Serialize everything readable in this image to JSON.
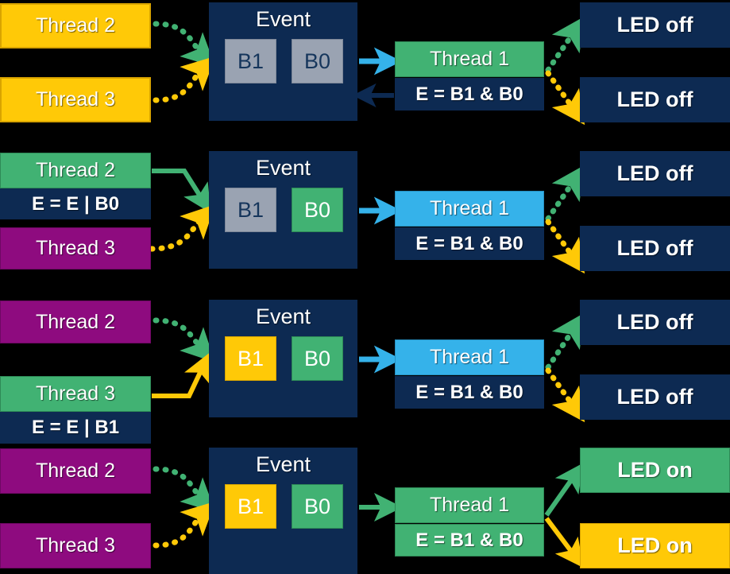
{
  "diagram": {
    "title_icon": "state-sequence-diagram",
    "colors": {
      "background": "#000000",
      "navy": "#0d2a52",
      "yellow": "#ffc907",
      "green": "#41b273",
      "purple": "#8e0b7f",
      "blue": "#35b2ea",
      "gray": "#9aa3b2",
      "white": "#ffffff",
      "navy_text": "#16365c"
    },
    "labels": {
      "event": "Event",
      "bit_high": "B1",
      "bit_low": "B0",
      "thread1": "Thread 1",
      "thread2": "Thread 2",
      "thread3": "Thread 3",
      "expr_and": "E = B1 & B0",
      "expr_or_b0": "E = E | B0",
      "expr_or_b1": "E = E | B1",
      "led_off": "LED off",
      "led_on": "LED on"
    },
    "rows": [
      {
        "index": 1,
        "left": [
          {
            "name": "thread-2-box",
            "label": "Thread 2",
            "fill": "yellow",
            "expr": null
          },
          {
            "name": "thread-3-box",
            "label": "Thread 3",
            "fill": "yellow",
            "expr": null
          }
        ],
        "event": {
          "label": "Event",
          "bits": [
            {
              "name": "B1",
              "fill": "gray"
            },
            {
              "name": "B0",
              "fill": "gray"
            }
          ]
        },
        "thread1": {
          "label": "Thread 1",
          "fill": "green",
          "expr": "E = B1 & B0",
          "expr_fill": "navy"
        },
        "leds": [
          {
            "name": "led-top",
            "label": "LED off",
            "fill": "navy"
          },
          {
            "name": "led-bottom",
            "label": "LED off",
            "fill": "navy"
          }
        ],
        "arrows": {
          "thread2_to_event": "green-dotted",
          "thread3_to_event": "yellow-dotted",
          "event_to_thread1": "blue-solid",
          "thread1_to_event": "navy-solid",
          "thread1_to_led_top": "green-dotted",
          "thread1_to_led_bottom": "yellow-dotted"
        }
      },
      {
        "index": 2,
        "left": [
          {
            "name": "thread-2-box",
            "label": "Thread 2",
            "fill": "green",
            "expr": "E = E | B0"
          },
          {
            "name": "thread-3-box",
            "label": "Thread 3",
            "fill": "purple",
            "expr": null
          }
        ],
        "event": {
          "label": "Event",
          "bits": [
            {
              "name": "B1",
              "fill": "gray"
            },
            {
              "name": "B0",
              "fill": "green"
            }
          ]
        },
        "thread1": {
          "label": "Thread 1",
          "fill": "blue",
          "expr": "E = B1 & B0",
          "expr_fill": "navy"
        },
        "leds": [
          {
            "name": "led-top",
            "label": "LED off",
            "fill": "navy"
          },
          {
            "name": "led-bottom",
            "label": "LED off",
            "fill": "navy"
          }
        ],
        "arrows": {
          "thread2_to_event": "green-solid",
          "thread3_to_event": "yellow-dotted",
          "event_to_thread1": "blue-solid",
          "thread1_to_led_top": "green-dotted",
          "thread1_to_led_bottom": "yellow-dotted"
        }
      },
      {
        "index": 3,
        "left": [
          {
            "name": "thread-2-box",
            "label": "Thread 2",
            "fill": "purple",
            "expr": null
          },
          {
            "name": "thread-3-box",
            "label": "Thread 3",
            "fill": "green",
            "expr": "E = E | B1"
          }
        ],
        "event": {
          "label": "Event",
          "bits": [
            {
              "name": "B1",
              "fill": "yellow"
            },
            {
              "name": "B0",
              "fill": "green"
            }
          ]
        },
        "thread1": {
          "label": "Thread 1",
          "fill": "blue",
          "expr": "E = B1 & B0",
          "expr_fill": "navy"
        },
        "leds": [
          {
            "name": "led-top",
            "label": "LED off",
            "fill": "navy"
          },
          {
            "name": "led-bottom",
            "label": "LED off",
            "fill": "navy"
          }
        ],
        "arrows": {
          "thread2_to_event": "green-dotted",
          "thread3_to_event": "yellow-solid",
          "event_to_thread1": "blue-solid",
          "thread1_to_led_top": "green-dotted",
          "thread1_to_led_bottom": "yellow-dotted"
        }
      },
      {
        "index": 4,
        "left": [
          {
            "name": "thread-2-box",
            "label": "Thread 2",
            "fill": "purple",
            "expr": null
          },
          {
            "name": "thread-3-box",
            "label": "Thread 3",
            "fill": "purple",
            "expr": null
          }
        ],
        "event": {
          "label": "Event",
          "bits": [
            {
              "name": "B1",
              "fill": "yellow"
            },
            {
              "name": "B0",
              "fill": "green"
            }
          ]
        },
        "thread1": {
          "label": "Thread 1",
          "fill": "green",
          "expr": "E = B1 & B0",
          "expr_fill": "green"
        },
        "leds": [
          {
            "name": "led-top",
            "label": "LED on",
            "fill": "green"
          },
          {
            "name": "led-bottom",
            "label": "LED on",
            "fill": "yellow"
          }
        ],
        "arrows": {
          "thread2_to_event": "green-dotted",
          "thread3_to_event": "yellow-dotted",
          "event_to_thread1": "green-solid",
          "thread1_to_led_top": "green-solid",
          "thread1_to_led_bottom": "yellow-solid"
        }
      }
    ]
  }
}
